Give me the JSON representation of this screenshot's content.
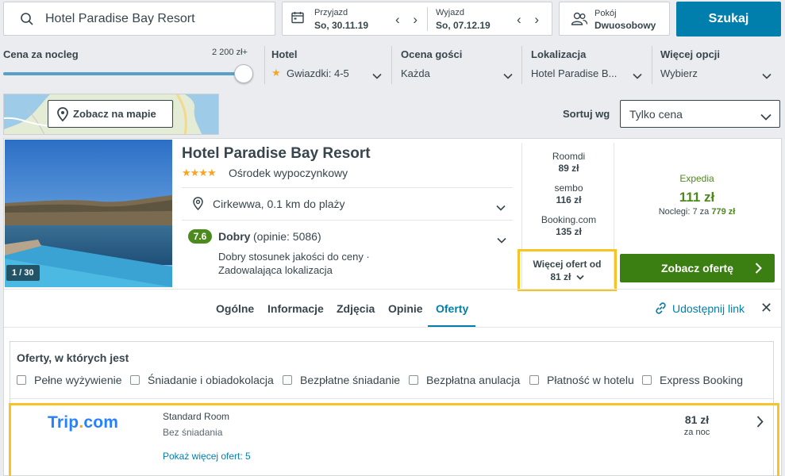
{
  "search": {
    "destination": "Hotel Paradise Bay Resort",
    "button_label": "Szukaj"
  },
  "dates": {
    "checkin_label": "Przyjazd",
    "checkin_value": "So, 30.11.19",
    "checkout_label": "Wyjazd",
    "checkout_value": "So, 07.12.19"
  },
  "room": {
    "label": "Pokój",
    "value": "Dwuosobowy"
  },
  "filters": {
    "price_label": "Cena za nocleg",
    "price_max": "2 200 zł+",
    "price_level_fraction": 1.0,
    "hotel_label": "Hotel",
    "hotel_value": "Gwiazdki: 4-5",
    "rating_label": "Ocena gości",
    "rating_value": "Każda",
    "location_label": "Lokalizacja",
    "location_value": "Hotel Paradise B...",
    "more_label": "Więcej opcji",
    "more_value": "Wybierz"
  },
  "map": {
    "button_label": "Zobacz na mapie"
  },
  "sort": {
    "label": "Sortuj wg",
    "value": "Tylko cena"
  },
  "hotel": {
    "name": "Hotel Paradise Bay Resort",
    "stars": "★★★★",
    "type": "Ośrodek wypoczynkowy",
    "image_counter": "1 / 30",
    "location": "Cirkewwa, 0.1 km do plaży",
    "rating_score": "7.6",
    "rating_word": "Dobry",
    "rating_count": "(opinie: 5086)",
    "rating_desc_1": "Dobry stosunek jakości do ceny ·",
    "rating_desc_2": "Zadowalająca lokalizacja"
  },
  "providers": [
    {
      "name": "Roomdi",
      "price": "89 zł"
    },
    {
      "name": "sembo",
      "price": "116 zł"
    },
    {
      "name": "Booking.com",
      "price": "135 zł"
    }
  ],
  "more_offers": {
    "line1": "Więcej ofert od",
    "line2": "81 zł"
  },
  "best_offer": {
    "provider": "Expedia",
    "price": "111 zł",
    "nights_text": "Noclegi: 7 za",
    "nights_total": "779 zł",
    "button_label": "Zobacz ofertę"
  },
  "tabs": [
    "Ogólne",
    "Informacje",
    "Zdjęcia",
    "Opinie",
    "Oferty"
  ],
  "share_label": "Udostępnij link",
  "offers_panel": {
    "title": "Oferty, w których jest",
    "checkboxes": [
      "Pełne wyżywienie",
      "Śniadanie i obiadokolacja",
      "Bezpłatne śniadanie",
      "Bezpłatna anulacja",
      "Płatność w hotelu",
      "Express Booking"
    ]
  },
  "offer_row": {
    "logo_a": "Trip",
    "logo_dot": ".",
    "logo_b": "com",
    "room_name": "Standard Room",
    "board": "Bez śniadania",
    "more_link": "Pokaż więcej ofert: 5",
    "price": "81 zł",
    "per_night": "za noc"
  },
  "colors": {
    "accent": "#007fad",
    "cta": "#3b7f13",
    "highlight": "#f7c325",
    "rating": "#4d8a1e"
  }
}
